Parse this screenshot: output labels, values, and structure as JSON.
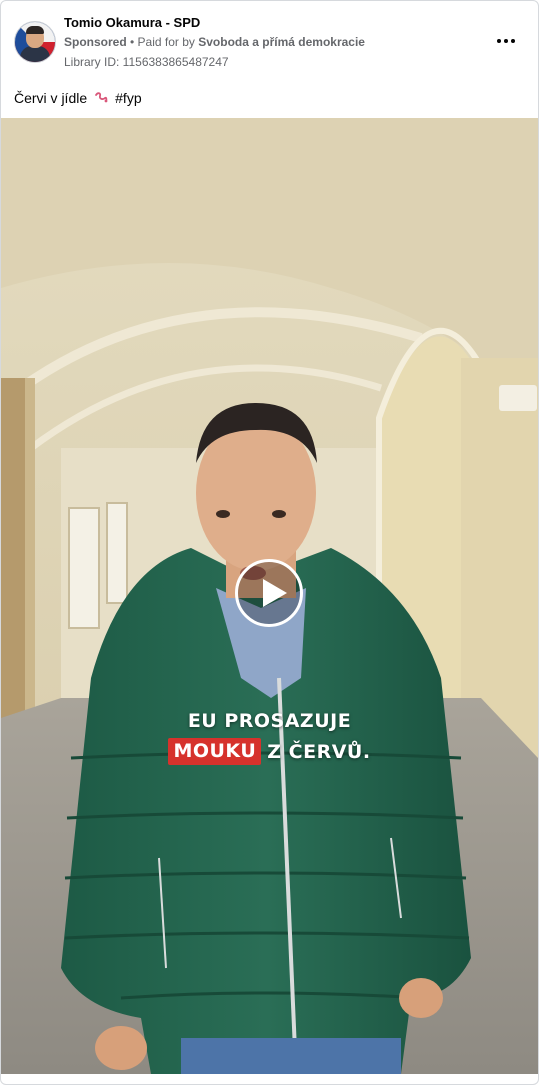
{
  "post": {
    "page_name": "Tomio Okamura - SPD",
    "sponsored_label": "Sponsored",
    "separator": " • ",
    "paid_for_prefix": "Paid for by ",
    "payer": "Svoboda a přímá demokracie",
    "library_id": "Library ID: 1156383865487247",
    "more_icon": "more-options-icon",
    "caption_text": "Červi v jídle",
    "caption_emoji": "worm-emoji-icon",
    "caption_hashtag": "#fyp"
  },
  "video": {
    "overlay_line1": "EU PROSAZUJE",
    "overlay_highlight": "MOUKU",
    "overlay_line2_rest": "Z ČERVŮ.",
    "highlight_color": "#d6322c",
    "play_icon": "play-icon"
  }
}
